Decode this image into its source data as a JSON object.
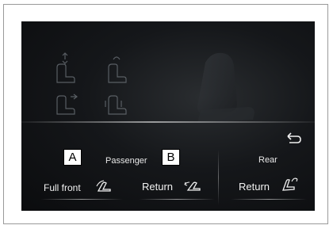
{
  "screen": {
    "passenger_label": "Passenger",
    "rear_label": "Rear",
    "full_front_label": "Full front",
    "return_label_1": "Return",
    "return_label_2": "Return"
  },
  "callouts": {
    "a": "A",
    "b": "B"
  },
  "icons": {
    "back": "return-arrow-icon",
    "full_front": "seat-recline-icon",
    "return_1": "seat-return-icon",
    "return_2": "rear-seat-return-icon"
  }
}
